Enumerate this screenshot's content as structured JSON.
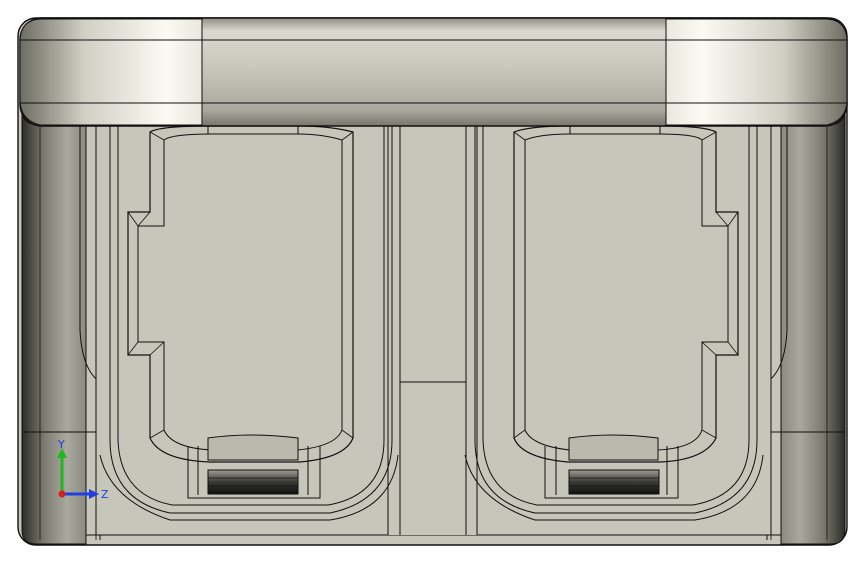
{
  "view": {
    "background": "#ffffff",
    "part_fill": "#c6c6bb",
    "edge_color": "#101010",
    "highlight": "#f6f6ee",
    "shadow": "#3a3a34",
    "slot_dark": "#1c1c1c"
  },
  "triad": {
    "y_label": "Y",
    "z_label": "Z",
    "y_color": "#1fb81f",
    "z_color": "#1f3fe0",
    "x_color": "#d81f1f"
  }
}
